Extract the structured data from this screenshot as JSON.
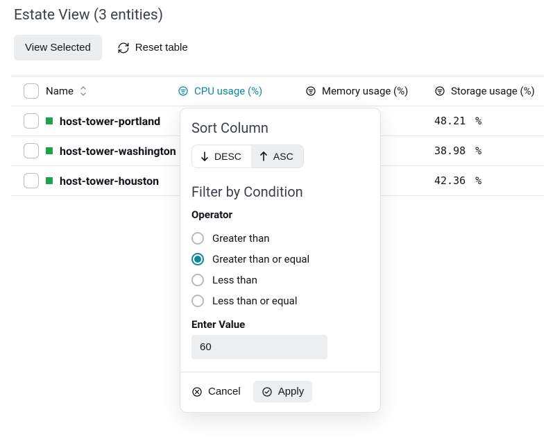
{
  "header": {
    "title": "Estate View (3 entities)"
  },
  "toolbar": {
    "view_selected_label": "View Selected",
    "reset_label": "Reset table"
  },
  "columns": {
    "name": "Name",
    "cpu": "CPU usage (%)",
    "mem": "Memory usage (%)",
    "sto": "Storage usage (%)"
  },
  "rows": [
    {
      "name": "host-tower-portland",
      "storage": "48.21"
    },
    {
      "name": "host-tower-washington",
      "storage": "38.98"
    },
    {
      "name": "host-tower-houston",
      "storage": "42.36"
    }
  ],
  "popover": {
    "sort_title": "Sort Column",
    "desc_label": "DESC",
    "asc_label": "ASC",
    "filter_title": "Filter by Condition",
    "operator_label": "Operator",
    "operators": {
      "gt": "Greater than",
      "gte": "Greater than or equal",
      "lt": "Less than",
      "lte": "Less than or equal",
      "selected": "gte"
    },
    "enter_value_label": "Enter Value",
    "value": "60",
    "cancel_label": "Cancel",
    "apply_label": "Apply"
  }
}
